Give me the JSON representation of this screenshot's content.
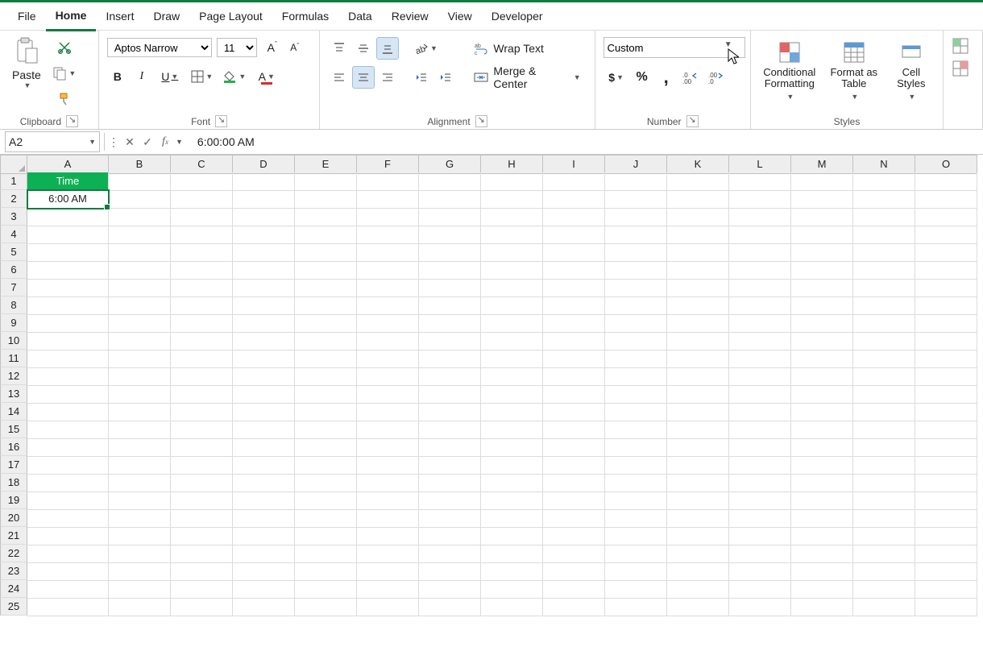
{
  "tabs": [
    "File",
    "Home",
    "Insert",
    "Draw",
    "Page Layout",
    "Formulas",
    "Data",
    "Review",
    "View",
    "Developer"
  ],
  "active_tab": 1,
  "clipboard": {
    "paste": "Paste",
    "label": "Clipboard"
  },
  "font": {
    "name": "Aptos Narrow",
    "size": "11",
    "label": "Font"
  },
  "align": {
    "wrap": "Wrap Text",
    "merge": "Merge & Center",
    "label": "Alignment"
  },
  "number": {
    "format": "Custom",
    "currency": "$",
    "thousand": ",",
    "label": "Number"
  },
  "styles": {
    "cond": "Conditional\nFormatting",
    "tbl": "Format as\nTable",
    "cell": "Cell\nStyles",
    "label": "Styles"
  },
  "namebox": "A2",
  "formula": "6:00:00 AM",
  "columns": [
    "A",
    "B",
    "C",
    "D",
    "E",
    "F",
    "G",
    "H",
    "I",
    "J",
    "K",
    "L",
    "M",
    "N",
    "O"
  ],
  "rows_count": 25,
  "cells": {
    "A1": "Time",
    "A2": "6:00 AM"
  },
  "active_cell": "A2",
  "percent_sign": "%"
}
